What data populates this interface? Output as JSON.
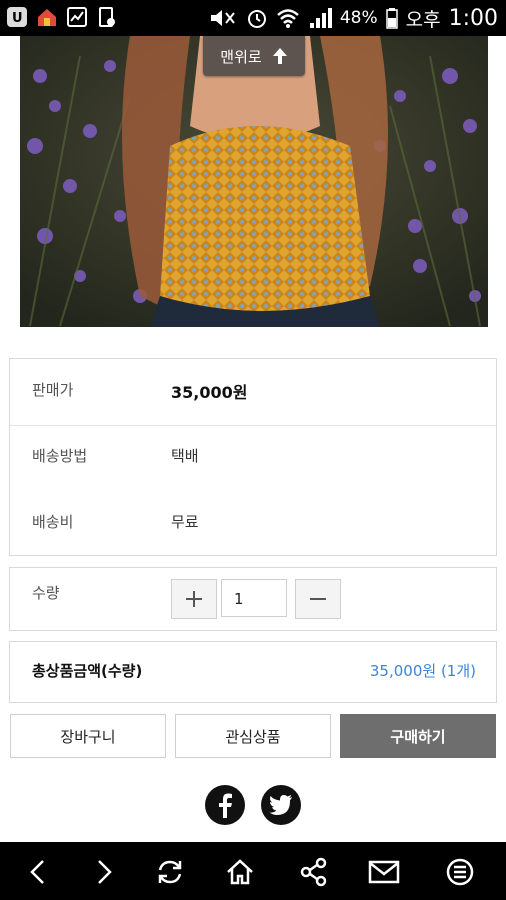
{
  "status_bar": {
    "battery_percent": "48%",
    "ampm": "오후",
    "time": "1:00"
  },
  "top_button": {
    "label": "맨위로"
  },
  "product_info": {
    "price_label": "판매가",
    "price_value": "35,000원",
    "shipping_method_label": "배송방법",
    "shipping_method_value": "택배",
    "shipping_fee_label": "배송비",
    "shipping_fee_value": "무료"
  },
  "quantity": {
    "label": "수량",
    "value": "1"
  },
  "total": {
    "label": "총상품금액(수량)",
    "value": "35,000원 (1개)"
  },
  "actions": {
    "cart_label": "장바구니",
    "wishlist_label": "관심상품",
    "buy_label": "구매하기"
  },
  "colors": {
    "accent_blue": "#3d84d6",
    "buy_button": "#6e6e6e"
  },
  "social_icons": [
    "facebook-icon",
    "twitter-icon"
  ],
  "nav_icons": [
    "back-icon",
    "forward-icon",
    "refresh-icon",
    "home-icon",
    "share-icon",
    "mail-icon",
    "menu-icon"
  ]
}
